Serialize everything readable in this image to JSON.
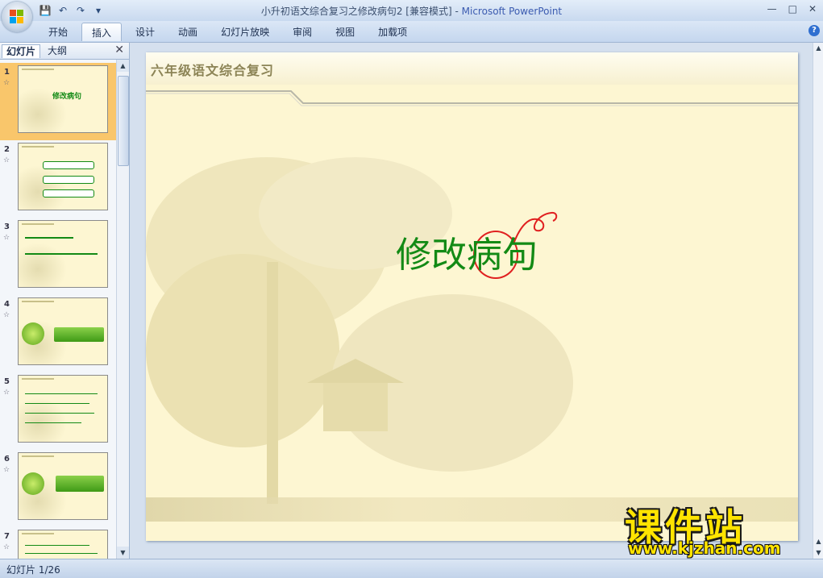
{
  "window": {
    "title": "小升初语文综合复习之修改病句2 [兼容模式]",
    "app_name": "Microsoft PowerPoint"
  },
  "ribbon": {
    "tabs": [
      {
        "label": "开始"
      },
      {
        "label": "插入",
        "active": true
      },
      {
        "label": "设计"
      },
      {
        "label": "动画"
      },
      {
        "label": "幻灯片放映"
      },
      {
        "label": "审阅"
      },
      {
        "label": "视图"
      },
      {
        "label": "加载项"
      }
    ]
  },
  "left_pane": {
    "tab_slides": "幻灯片",
    "tab_outline": "大纲",
    "close_glyph": "✕",
    "thumbnails": [
      {
        "num": "1",
        "star": "☆",
        "selected": true
      },
      {
        "num": "2",
        "star": "☆"
      },
      {
        "num": "3",
        "star": "☆"
      },
      {
        "num": "4",
        "star": "☆"
      },
      {
        "num": "5",
        "star": "☆"
      },
      {
        "num": "6",
        "star": "☆"
      },
      {
        "num": "7",
        "star": "☆"
      }
    ]
  },
  "slide": {
    "header": "六年级语文综合复习",
    "main_title": "修改病句"
  },
  "status": {
    "slide_counter": "幻灯片 1/26"
  },
  "watermark": {
    "brand": "课件站",
    "url": "www.kjzhan.com"
  },
  "colors": {
    "title_green": "#138a15",
    "ring_red": "#e02020",
    "selected_thumb": "#f9c66b",
    "slide_bg": "#fdf6d2"
  }
}
